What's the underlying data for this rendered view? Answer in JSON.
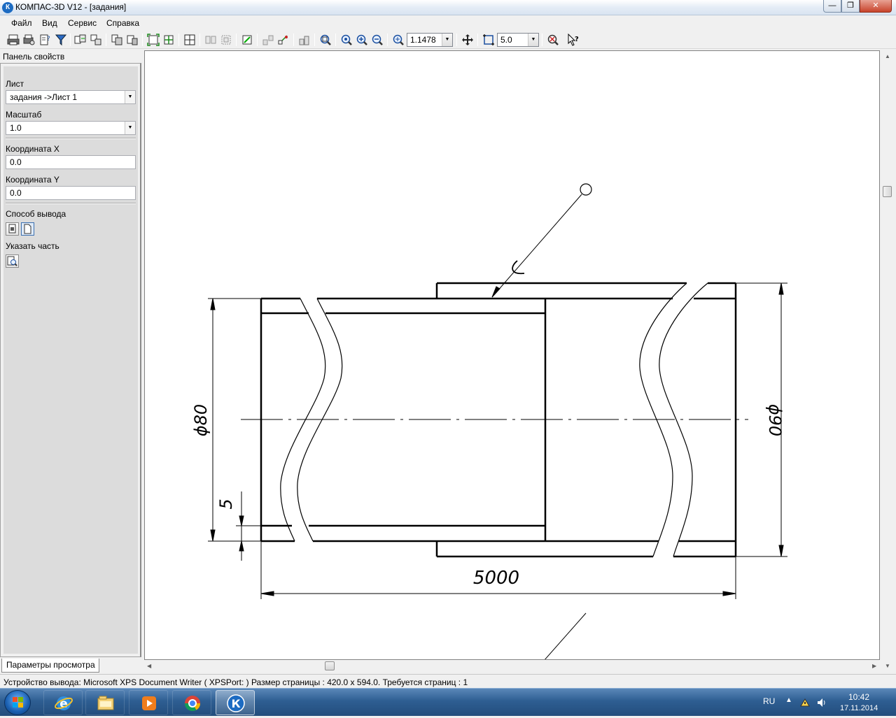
{
  "window": {
    "title": "КОМПАС-3D V12 - [задания]",
    "app_icon": "К",
    "controls": {
      "minimize": "—",
      "maximize": "❐",
      "close": "✕"
    }
  },
  "menu": {
    "items": [
      "Файл",
      "Вид",
      "Сервис",
      "Справка"
    ]
  },
  "toolbar": {
    "zoom_value": "1.1478",
    "step_value": "5.0",
    "icons": [
      "print-icon",
      "printer-setup-icon",
      "preview-settings-icon",
      "filter-icon",
      "layout-icon",
      "layout2-icon",
      "copy-sheets-icon",
      "paste-sheets-icon",
      "fit-page-icon",
      "fit-all-icon",
      "grid-icon",
      "tile-icon",
      "tile2-icon",
      "fit-object-icon",
      "align-icon",
      "align2-icon",
      "zoom-window-icon",
      "zoom-in-icon",
      "zoom-out-icon",
      "zoom-previous-icon",
      "zoom-scale-icon",
      "pan-icon",
      "rotate-step-icon",
      "properties-icon",
      "help-cursor-icon"
    ]
  },
  "panel": {
    "header": "Панель свойств",
    "sheet_label": "Лист",
    "sheet_value": "задания ->Лист 1",
    "scale_label": "Масштаб",
    "scale_value": "1.0",
    "coord_x_label": "Координата X",
    "coord_x_value": "0.0",
    "coord_y_label": "Координата Y",
    "coord_y_value": "0.0",
    "output_label": "Способ вывода",
    "part_label": "Указать часть",
    "tab_label": "Параметры просмотра"
  },
  "drawing": {
    "dim_d80": "ϕ80",
    "dim_d90": "ϕ90",
    "dim_5": "5",
    "dim_5000": "5000"
  },
  "status": {
    "text": "Устройство вывода: Microsoft XPS Document Writer ( XPSPort: )  Размер страницы : 420.0 x 594.0.  Требуется страниц : 1"
  },
  "taskbar": {
    "apps": [
      "internet-explorer-icon",
      "file-explorer-icon",
      "media-player-icon",
      "chrome-icon",
      "kompas-icon"
    ],
    "lang": "RU",
    "time": "10:42",
    "date": "17.11.2014"
  },
  "colors": {
    "title_gradient": "#d9e4f1",
    "taskbar": "#2e5e92",
    "panel_bg": "#dcdcdc"
  }
}
